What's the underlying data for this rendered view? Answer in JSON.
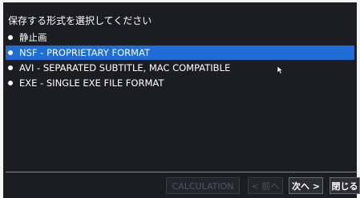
{
  "dialog": {
    "prompt": "保存する形式を選択してください",
    "options": [
      {
        "label": "静止画",
        "selected": false
      },
      {
        "label": "NSF - PROPRIETARY FORMAT",
        "selected": true
      },
      {
        "label": "AVI - SEPARATED SUBTITLE, MAC COMPATIBLE",
        "selected": false
      },
      {
        "label": "EXE - SINGLE EXE FILE FORMAT",
        "selected": false
      }
    ],
    "buttons": {
      "calculation": "CALCULATION",
      "prev": "< 前へ",
      "next": "次へ >",
      "close": "閉じる"
    }
  },
  "colors": {
    "background": "#1c1d23",
    "selection": "#1e6dd6",
    "text": "#ffffff",
    "disabled_text": "#50535c"
  },
  "icons": {
    "cursor": "mouse-pointer-icon",
    "bullet": "bullet-icon"
  }
}
